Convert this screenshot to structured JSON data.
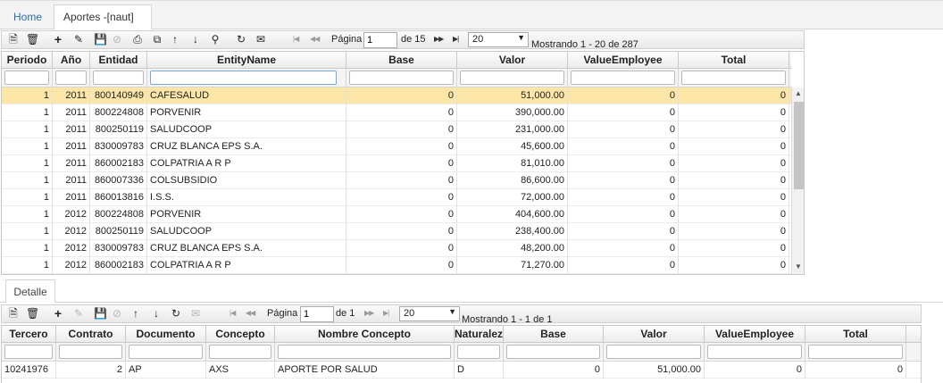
{
  "tabs": {
    "home": "Home",
    "active": "Aportes -[naut]",
    "close": "×"
  },
  "main_toolbar": {
    "page_label": "Página",
    "page_value": "1",
    "of_label": "de 15",
    "page_size": "20",
    "summary": "Mostrando 1 - 20 de 287"
  },
  "main_grid": {
    "columns": [
      "Periodo",
      "Año",
      "Entidad",
      "EntityName",
      "Base",
      "Valor",
      "ValueEmployee",
      "Total"
    ],
    "rows": [
      [
        "1",
        "2011",
        "800140949",
        "CAFESALUD",
        "0",
        "51,000.00",
        "0",
        "0"
      ],
      [
        "1",
        "2011",
        "800224808",
        "PORVENIR",
        "0",
        "390,000.00",
        "0",
        "0"
      ],
      [
        "1",
        "2011",
        "800250119",
        "SALUDCOOP",
        "0",
        "231,000.00",
        "0",
        "0"
      ],
      [
        "1",
        "2011",
        "830009783",
        "CRUZ BLANCA EPS S.A.",
        "0",
        "45,600.00",
        "0",
        "0"
      ],
      [
        "1",
        "2011",
        "860002183",
        "COLPATRIA   A R P",
        "0",
        "81,010.00",
        "0",
        "0"
      ],
      [
        "1",
        "2011",
        "860007336",
        "COLSUBSIDIO",
        "0",
        "86,600.00",
        "0",
        "0"
      ],
      [
        "1",
        "2011",
        "860013816",
        "I.S.S.",
        "0",
        "72,000.00",
        "0",
        "0"
      ],
      [
        "1",
        "2012",
        "800224808",
        "PORVENIR",
        "0",
        "404,600.00",
        "0",
        "0"
      ],
      [
        "1",
        "2012",
        "800250119",
        "SALUDCOOP",
        "0",
        "238,400.00",
        "0",
        "0"
      ],
      [
        "1",
        "2012",
        "830009783",
        "CRUZ BLANCA EPS S.A.",
        "0",
        "48,200.00",
        "0",
        "0"
      ],
      [
        "1",
        "2012",
        "860002183",
        "COLPATRIA   A R P",
        "0",
        "71,270.00",
        "0",
        "0"
      ]
    ]
  },
  "detail_tab": "Detalle",
  "detail_toolbar": {
    "page_label": "Página",
    "page_value": "1",
    "of_label": "de 1",
    "page_size": "20",
    "summary": "Mostrando 1 - 1 de 1"
  },
  "detail_grid": {
    "columns": [
      "Tercero",
      "Contrato",
      "Documento",
      "Concepto",
      "Nombre Concepto",
      "Naturalez",
      "Base",
      "Valor",
      "ValueEmployee",
      "Total"
    ],
    "rows": [
      [
        "10241976",
        "2",
        "AP",
        "AXS",
        "APORTE POR SALUD",
        "D",
        "0",
        "51,000.00",
        "0",
        "0"
      ]
    ]
  }
}
